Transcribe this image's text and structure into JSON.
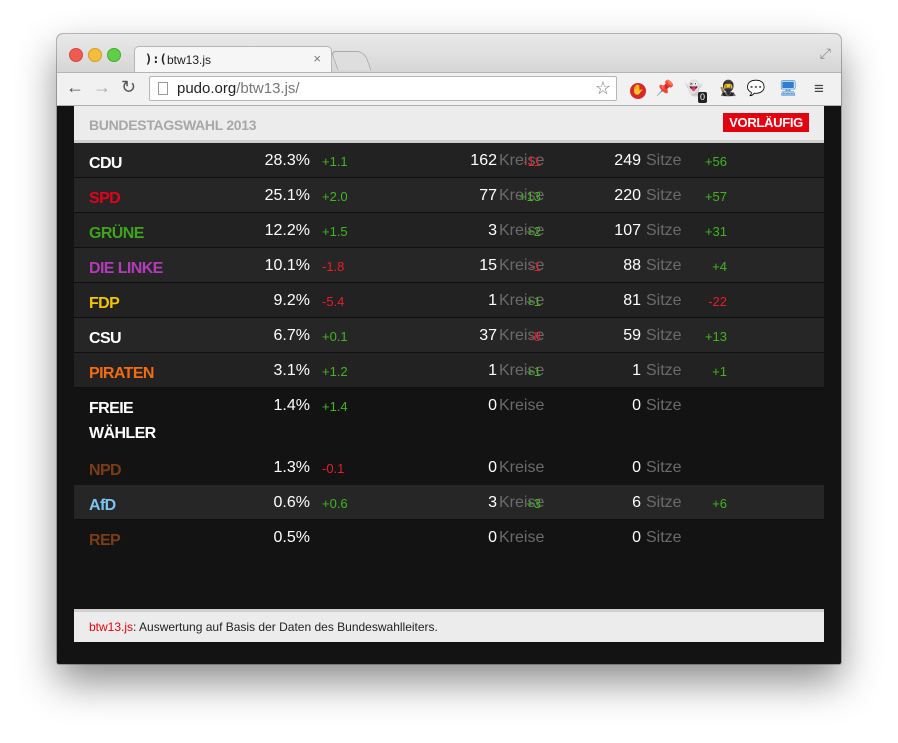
{
  "browser": {
    "tab_icon": "):(",
    "tab_title": "btw13.js",
    "tab_close": "×",
    "url_host": "pudo.org",
    "url_path": "/btw13.js/",
    "ext_badge": "0"
  },
  "header": {
    "title": "BUNDESTAGSWAHL 2013",
    "badge": "VORLÄUFIG"
  },
  "labels": {
    "kreise": "Kreise",
    "sitze": "Sitze"
  },
  "colors": {
    "positive": "#42b51f",
    "negative": "#e81d2b",
    "badge": "#e3020f"
  },
  "results": [
    {
      "party": "CDU",
      "color": "#ffffff",
      "percent": "28.3%",
      "percent_change": "+1.1",
      "kreise": "162",
      "kreise_change": "-11",
      "sitze": "249",
      "sitze_change": "+56"
    },
    {
      "party": "SPD",
      "color": "#e2001a",
      "percent": "25.1%",
      "percent_change": "+2.0",
      "kreise": "77",
      "kreise_change": "+13",
      "sitze": "220",
      "sitze_change": "+57"
    },
    {
      "party": "GRÜNE",
      "color": "#3fa31d",
      "percent": "12.2%",
      "percent_change": "+1.5",
      "kreise": "3",
      "kreise_change": "+2",
      "sitze": "107",
      "sitze_change": "+31"
    },
    {
      "party": "DIE LINKE",
      "color": "#b23bb6",
      "percent": "10.1%",
      "percent_change": "-1.8",
      "kreise": "15",
      "kreise_change": "-1",
      "sitze": "88",
      "sitze_change": "+4"
    },
    {
      "party": "FDP",
      "color": "#f5c400",
      "percent": "9.2%",
      "percent_change": "-5.4",
      "kreise": "1",
      "kreise_change": "+1",
      "sitze": "81",
      "sitze_change": "-22"
    },
    {
      "party": "CSU",
      "color": "#ffffff",
      "percent": "6.7%",
      "percent_change": "+0.1",
      "kreise": "37",
      "kreise_change": "-8",
      "sitze": "59",
      "sitze_change": "+13"
    },
    {
      "party": "PIRATEN",
      "color": "#f26c0f",
      "percent": "3.1%",
      "percent_change": "+1.2",
      "kreise": "1",
      "kreise_change": "+1",
      "sitze": "1",
      "sitze_change": "+1"
    },
    {
      "party": "FREIE WÄHLER",
      "color": "#ffffff",
      "percent": "1.4%",
      "percent_change": "+1.4",
      "kreise": "0",
      "kreise_change": "",
      "sitze": "0",
      "sitze_change": ""
    },
    {
      "party": "NPD",
      "color": "#7a3e16",
      "percent": "1.3%",
      "percent_change": "-0.1",
      "kreise": "0",
      "kreise_change": "",
      "sitze": "0",
      "sitze_change": ""
    },
    {
      "party": "AfD",
      "color": "#7dc3f0",
      "percent": "0.6%",
      "percent_change": "+0.6",
      "kreise": "3",
      "kreise_change": "+3",
      "sitze": "6",
      "sitze_change": "+6"
    },
    {
      "party": "REP",
      "color": "#7a3e16",
      "percent": "0.5%",
      "percent_change": "",
      "kreise": "0",
      "kreise_change": "",
      "sitze": "0",
      "sitze_change": ""
    }
  ],
  "footer": {
    "link": "btw13.js",
    "text": ": Auswertung auf Basis der Daten des Bundeswahlleiters."
  }
}
